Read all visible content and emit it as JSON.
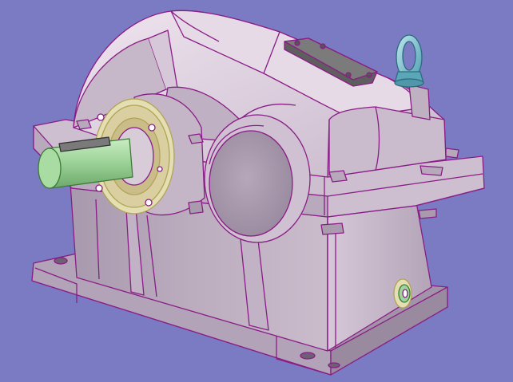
{
  "viewport": {
    "background_color": "#7b7bc4",
    "edge_color": "#8a1d86",
    "housing_color": "#d2c3d4",
    "shaft_color": "#9fd49a",
    "flange_color": "#e4dfb2",
    "eyebolt_color": "#6ab8c9",
    "plate_color": "#6b6b6b"
  }
}
